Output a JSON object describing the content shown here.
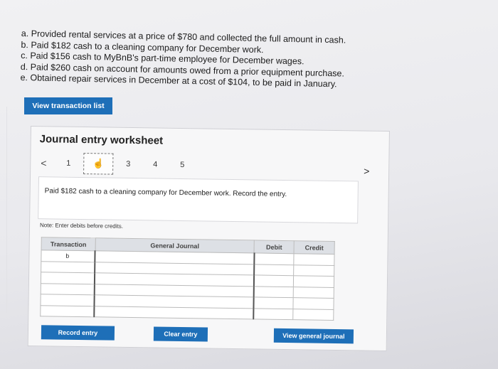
{
  "transactions": [
    "a. Provided rental services at a price of $780 and collected the full amount in cash.",
    "b. Paid $182 cash to a cleaning company for December work.",
    "c. Paid $156 cash to MyBnB's part-time employee for December wages.",
    "d. Paid $260 cash on account for amounts owed from a prior equipment purchase.",
    "e. Obtained repair services in December at a cost of $104, to be paid in January."
  ],
  "view_list_label": "View transaction list",
  "worksheet": {
    "title": "Journal entry worksheet",
    "nav": {
      "prev": "<",
      "next": ">",
      "pages": [
        "1",
        "2",
        "3",
        "4",
        "5"
      ],
      "active": "2"
    },
    "description": "Paid $182 cash to a cleaning company for December work. Record the entry.",
    "note": "Note: Enter debits before credits.",
    "table": {
      "headers": [
        "Transaction",
        "General Journal",
        "Debit",
        "Credit"
      ],
      "rows": [
        [
          "b",
          "",
          "",
          ""
        ],
        [
          "",
          "",
          "",
          ""
        ],
        [
          "",
          "",
          "",
          ""
        ],
        [
          "",
          "",
          "",
          ""
        ],
        [
          "",
          "",
          "",
          ""
        ],
        [
          "",
          "",
          "",
          ""
        ]
      ]
    },
    "buttons": {
      "record": "Record entry",
      "clear": "Clear entry",
      "general": "View general journal"
    }
  },
  "icons": {
    "cursor": "hand-pointer-icon"
  }
}
